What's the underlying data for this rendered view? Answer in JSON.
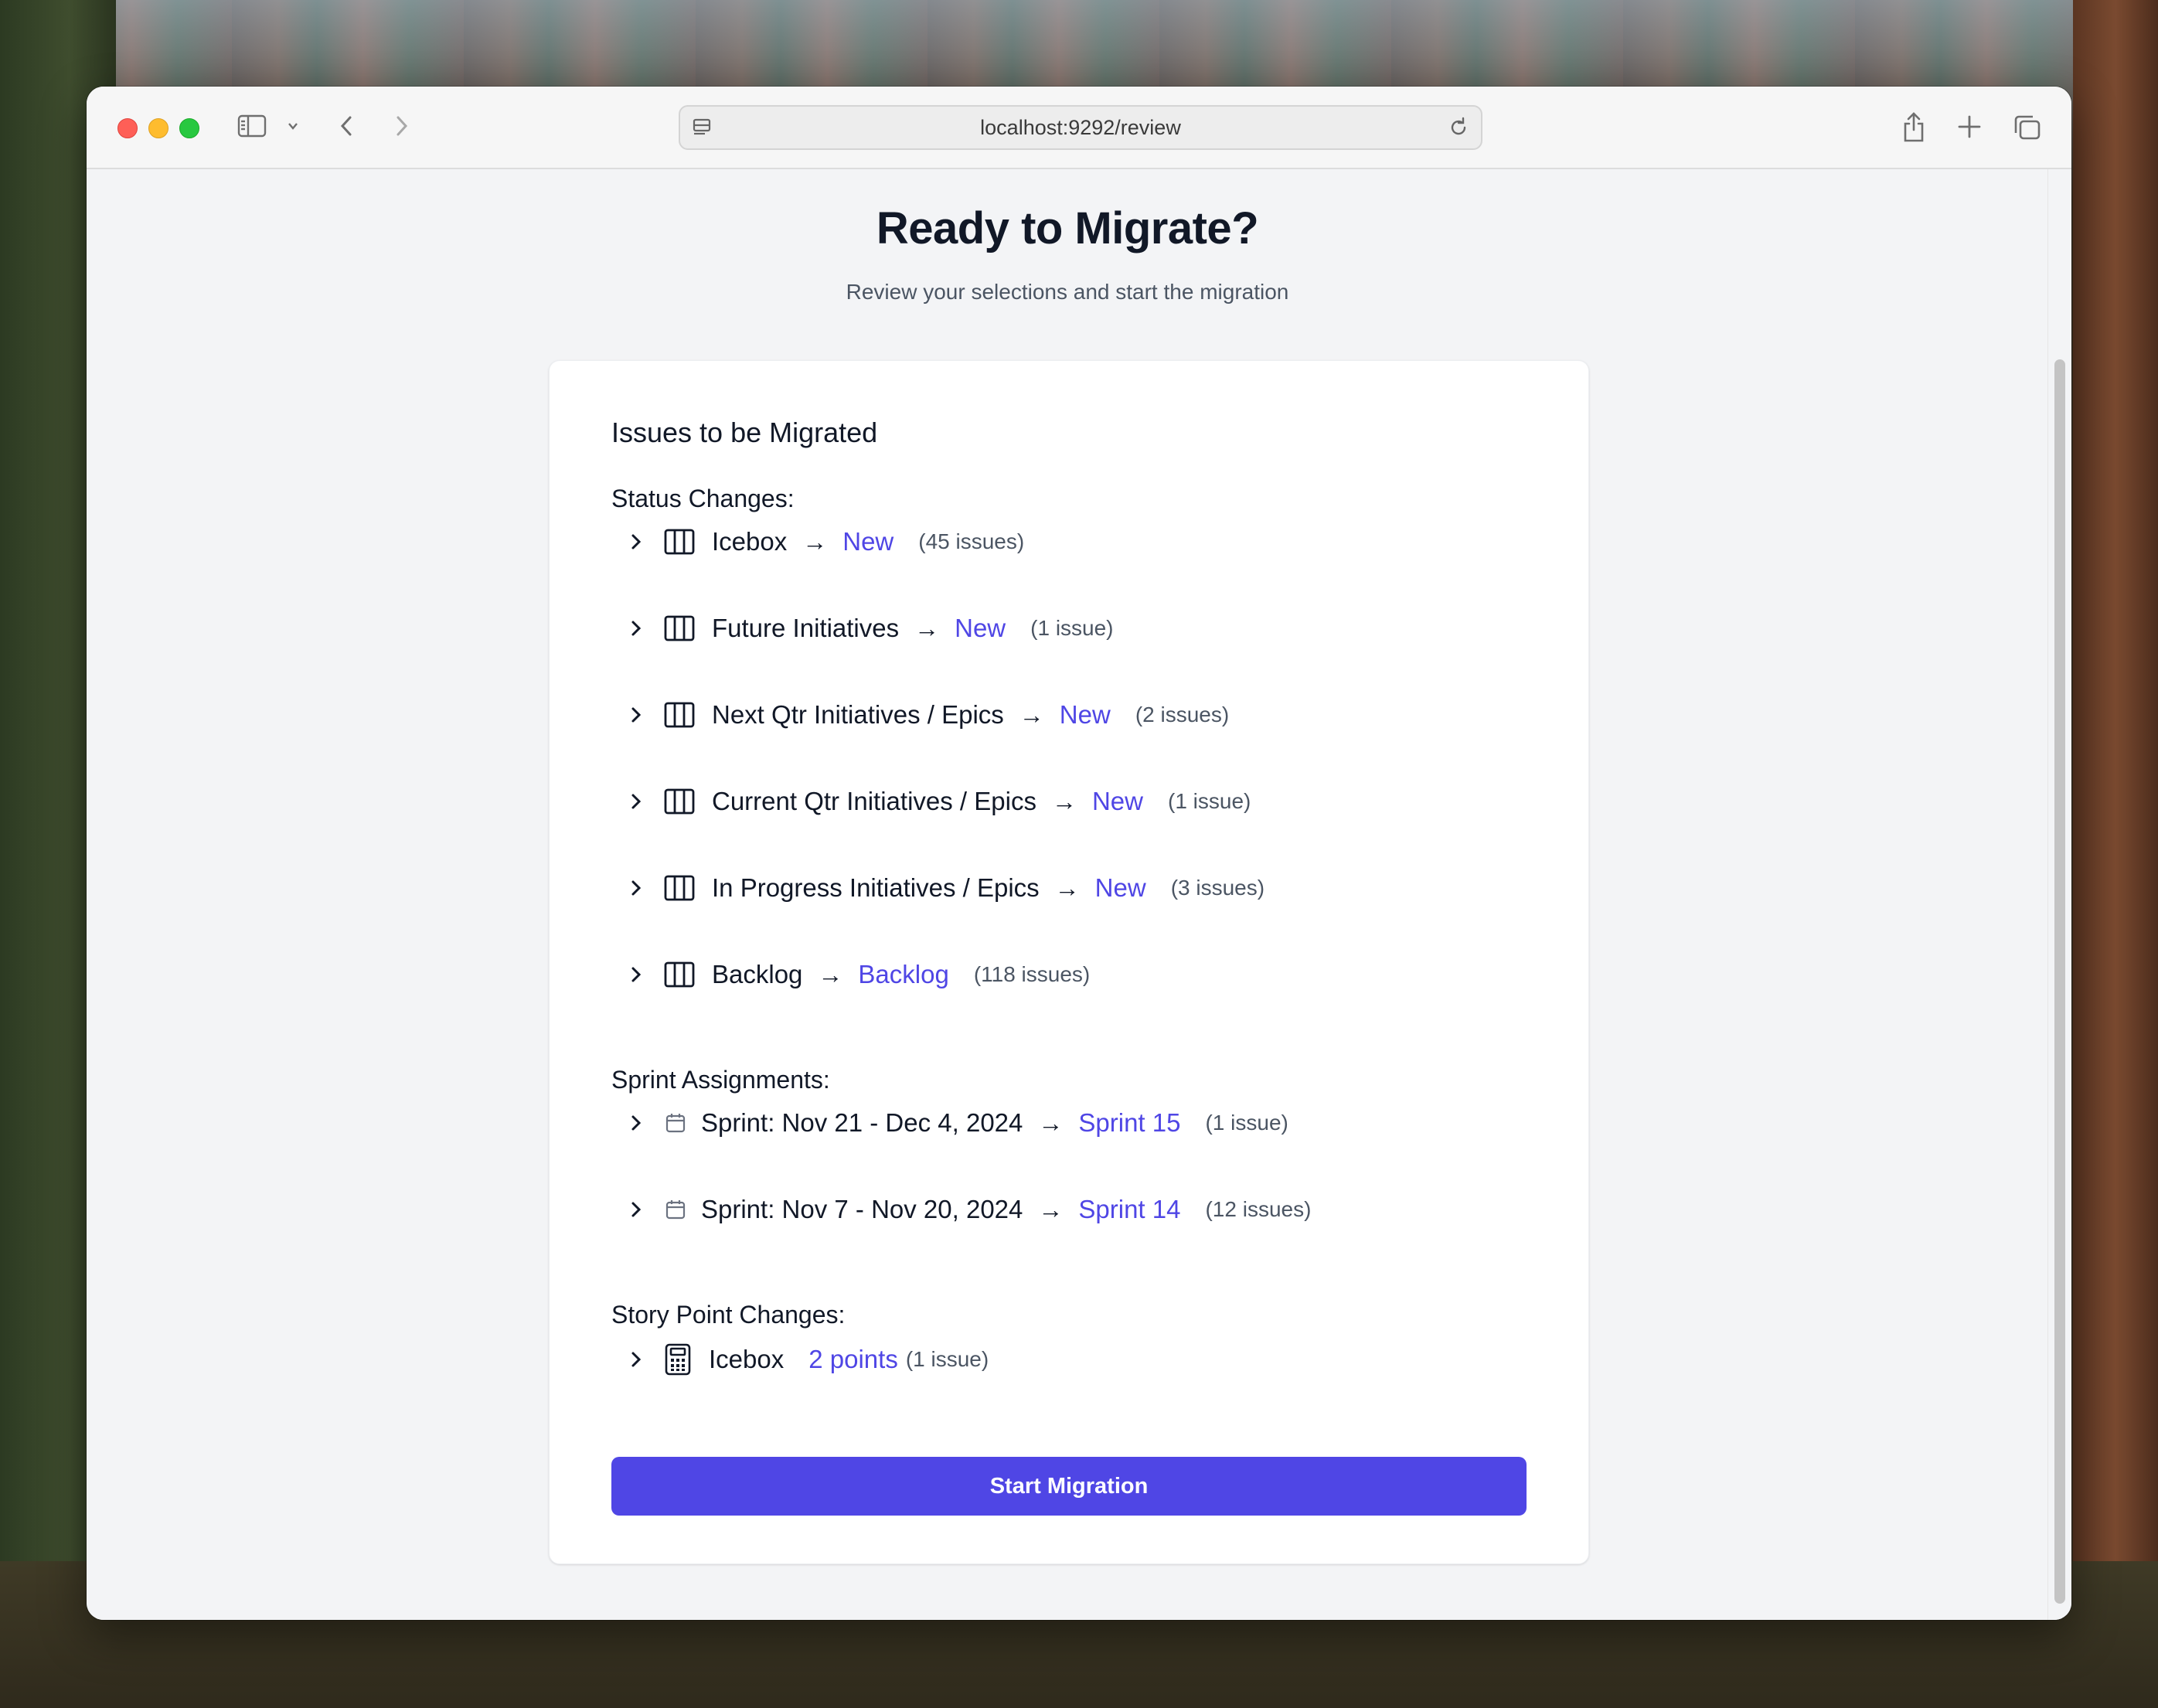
{
  "browser": {
    "url": "localhost:9292/review"
  },
  "page": {
    "title": "Ready to Migrate?",
    "subtitle": "Review your selections and start the migration"
  },
  "card": {
    "title": "Issues to be Migrated",
    "status_heading": "Status Changes:",
    "status_changes": [
      {
        "from": "Icebox",
        "to": "New",
        "count": "(45 issues)"
      },
      {
        "from": "Future Initiatives",
        "to": "New",
        "count": "(1 issue)"
      },
      {
        "from": "Next Qtr Initiatives / Epics",
        "to": "New",
        "count": "(2 issues)"
      },
      {
        "from": "Current Qtr Initiatives / Epics",
        "to": "New",
        "count": "(1 issue)"
      },
      {
        "from": "In Progress Initiatives / Epics",
        "to": "New",
        "count": "(3 issues)"
      },
      {
        "from": "Backlog",
        "to": "Backlog",
        "count": "(118 issues)"
      }
    ],
    "sprint_heading": "Sprint Assignments:",
    "sprint_assignments": [
      {
        "from": "Sprint: Nov 21 - Dec 4, 2024",
        "to": "Sprint 15",
        "count": "(1 issue)"
      },
      {
        "from": "Sprint: Nov 7 - Nov 20, 2024",
        "to": "Sprint 14",
        "count": "(12 issues)"
      }
    ],
    "points_heading": "Story Point Changes:",
    "story_point_changes": [
      {
        "from": "Icebox",
        "points": "2 points",
        "count": "(1 issue)"
      }
    ],
    "arrow": "→",
    "start_button": "Start Migration"
  },
  "colors": {
    "accent": "#4f46e5",
    "heading": "#111827",
    "muted": "#4b5563"
  }
}
